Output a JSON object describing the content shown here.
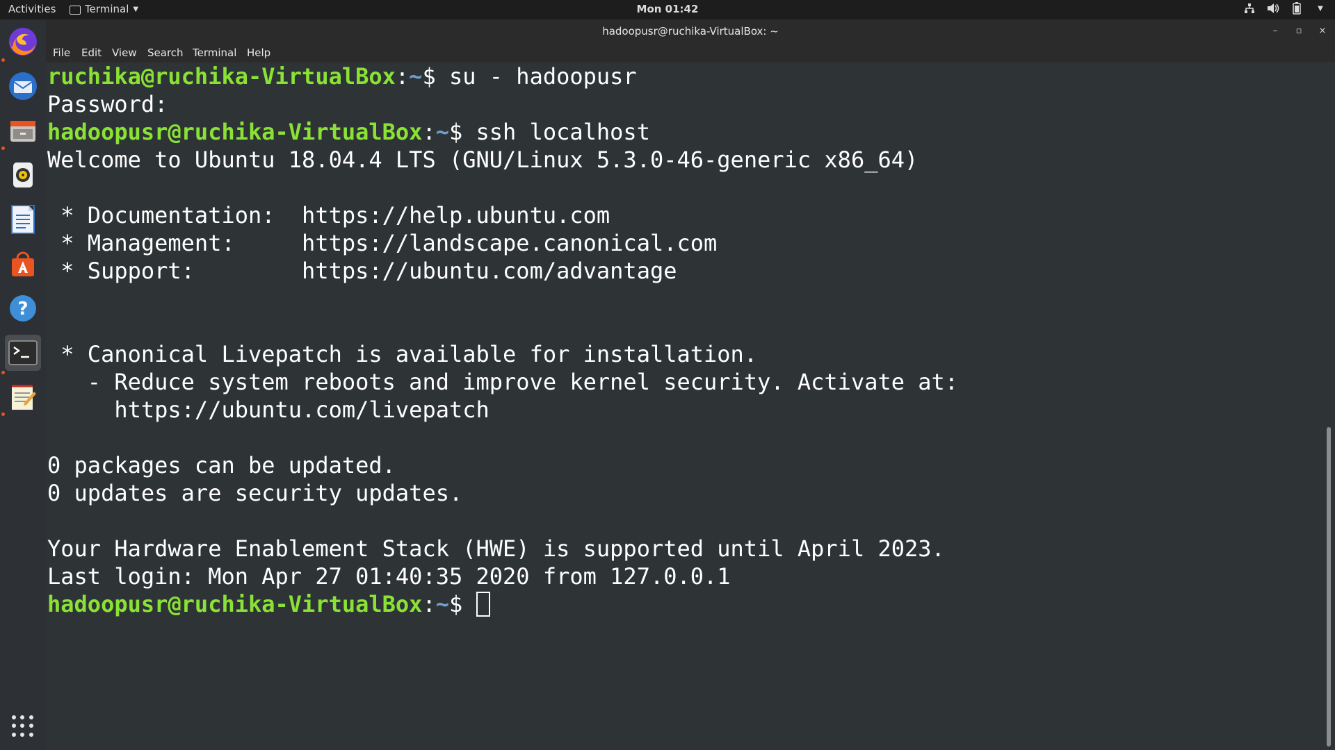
{
  "topbar": {
    "activities": "Activities",
    "app_menu": "Terminal",
    "clock": "Mon 01:42",
    "tray_icons": [
      "network-icon",
      "volume-icon",
      "battery-icon",
      "system-menu-caret-icon"
    ]
  },
  "dock": {
    "apps": [
      "firefox",
      "thunderbird",
      "files",
      "rhythmbox",
      "libreoffice-writer",
      "ubuntu-software",
      "help",
      "terminal",
      "text-editor"
    ],
    "show_apps": "show-applications-icon"
  },
  "window": {
    "title": "hadoopusr@ruchika-VirtualBox: ~",
    "menu": [
      "File",
      "Edit",
      "View",
      "Search",
      "Terminal",
      "Help"
    ]
  },
  "terminal": {
    "l1": {
      "user": "ruchika@ruchika-VirtualBox",
      "colon": ":",
      "path": "~",
      "cmd": "$ su - hadoopusr"
    },
    "l2": "Password:",
    "l3": {
      "user": "hadoopusr@ruchika-VirtualBox",
      "colon": ":",
      "path": "~",
      "cmd": "$ ssh localhost"
    },
    "l4": "Welcome to Ubuntu 18.04.4 LTS (GNU/Linux 5.3.0-46-generic x86_64)",
    "l6": " * Documentation:  https://help.ubuntu.com",
    "l7": " * Management:     https://landscape.canonical.com",
    "l8": " * Support:        https://ubuntu.com/advantage",
    "l11": " * Canonical Livepatch is available for installation.",
    "l12": "   - Reduce system reboots and improve kernel security. Activate at:",
    "l13": "     https://ubuntu.com/livepatch",
    "l15": "0 packages can be updated.",
    "l16": "0 updates are security updates.",
    "l18": "Your Hardware Enablement Stack (HWE) is supported until April 2023.",
    "l19": "Last login: Mon Apr 27 01:40:35 2020 from 127.0.0.1",
    "l20": {
      "user": "hadoopusr@ruchika-VirtualBox",
      "colon": ":",
      "path": "~",
      "cmd": "$ "
    }
  },
  "colors": {
    "prompt_user": "#8ae234",
    "prompt_path": "#729fcf",
    "terminal_bg": "#2e3436",
    "accent": "#e95420"
  }
}
